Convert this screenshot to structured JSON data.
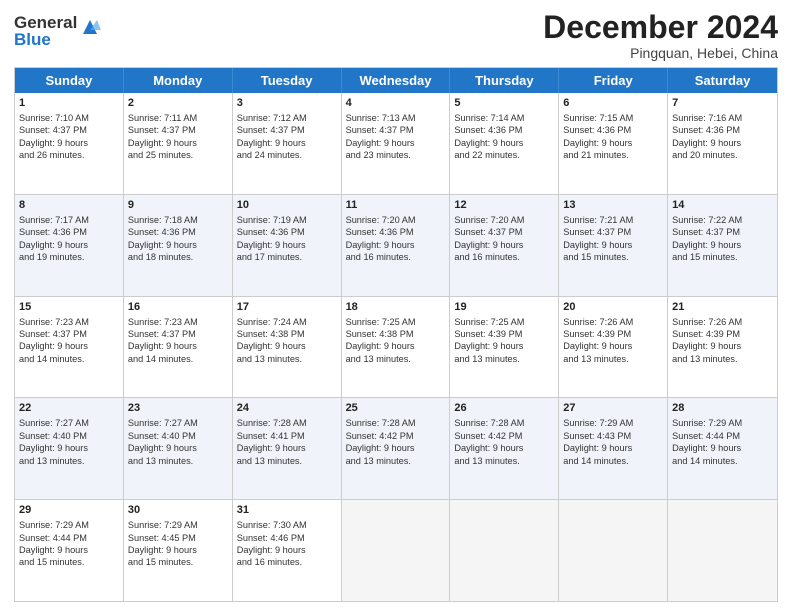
{
  "logo": {
    "general": "General",
    "blue": "Blue"
  },
  "title": "December 2024",
  "subtitle": "Pingquan, Hebei, China",
  "days": [
    "Sunday",
    "Monday",
    "Tuesday",
    "Wednesday",
    "Thursday",
    "Friday",
    "Saturday"
  ],
  "rows": [
    [
      {
        "day": "1",
        "lines": [
          "Sunrise: 7:10 AM",
          "Sunset: 4:37 PM",
          "Daylight: 9 hours",
          "and 26 minutes."
        ]
      },
      {
        "day": "2",
        "lines": [
          "Sunrise: 7:11 AM",
          "Sunset: 4:37 PM",
          "Daylight: 9 hours",
          "and 25 minutes."
        ]
      },
      {
        "day": "3",
        "lines": [
          "Sunrise: 7:12 AM",
          "Sunset: 4:37 PM",
          "Daylight: 9 hours",
          "and 24 minutes."
        ]
      },
      {
        "day": "4",
        "lines": [
          "Sunrise: 7:13 AM",
          "Sunset: 4:37 PM",
          "Daylight: 9 hours",
          "and 23 minutes."
        ]
      },
      {
        "day": "5",
        "lines": [
          "Sunrise: 7:14 AM",
          "Sunset: 4:36 PM",
          "Daylight: 9 hours",
          "and 22 minutes."
        ]
      },
      {
        "day": "6",
        "lines": [
          "Sunrise: 7:15 AM",
          "Sunset: 4:36 PM",
          "Daylight: 9 hours",
          "and 21 minutes."
        ]
      },
      {
        "day": "7",
        "lines": [
          "Sunrise: 7:16 AM",
          "Sunset: 4:36 PM",
          "Daylight: 9 hours",
          "and 20 minutes."
        ]
      }
    ],
    [
      {
        "day": "8",
        "lines": [
          "Sunrise: 7:17 AM",
          "Sunset: 4:36 PM",
          "Daylight: 9 hours",
          "and 19 minutes."
        ]
      },
      {
        "day": "9",
        "lines": [
          "Sunrise: 7:18 AM",
          "Sunset: 4:36 PM",
          "Daylight: 9 hours",
          "and 18 minutes."
        ]
      },
      {
        "day": "10",
        "lines": [
          "Sunrise: 7:19 AM",
          "Sunset: 4:36 PM",
          "Daylight: 9 hours",
          "and 17 minutes."
        ]
      },
      {
        "day": "11",
        "lines": [
          "Sunrise: 7:20 AM",
          "Sunset: 4:36 PM",
          "Daylight: 9 hours",
          "and 16 minutes."
        ]
      },
      {
        "day": "12",
        "lines": [
          "Sunrise: 7:20 AM",
          "Sunset: 4:37 PM",
          "Daylight: 9 hours",
          "and 16 minutes."
        ]
      },
      {
        "day": "13",
        "lines": [
          "Sunrise: 7:21 AM",
          "Sunset: 4:37 PM",
          "Daylight: 9 hours",
          "and 15 minutes."
        ]
      },
      {
        "day": "14",
        "lines": [
          "Sunrise: 7:22 AM",
          "Sunset: 4:37 PM",
          "Daylight: 9 hours",
          "and 15 minutes."
        ]
      }
    ],
    [
      {
        "day": "15",
        "lines": [
          "Sunrise: 7:23 AM",
          "Sunset: 4:37 PM",
          "Daylight: 9 hours",
          "and 14 minutes."
        ]
      },
      {
        "day": "16",
        "lines": [
          "Sunrise: 7:23 AM",
          "Sunset: 4:37 PM",
          "Daylight: 9 hours",
          "and 14 minutes."
        ]
      },
      {
        "day": "17",
        "lines": [
          "Sunrise: 7:24 AM",
          "Sunset: 4:38 PM",
          "Daylight: 9 hours",
          "and 13 minutes."
        ]
      },
      {
        "day": "18",
        "lines": [
          "Sunrise: 7:25 AM",
          "Sunset: 4:38 PM",
          "Daylight: 9 hours",
          "and 13 minutes."
        ]
      },
      {
        "day": "19",
        "lines": [
          "Sunrise: 7:25 AM",
          "Sunset: 4:39 PM",
          "Daylight: 9 hours",
          "and 13 minutes."
        ]
      },
      {
        "day": "20",
        "lines": [
          "Sunrise: 7:26 AM",
          "Sunset: 4:39 PM",
          "Daylight: 9 hours",
          "and 13 minutes."
        ]
      },
      {
        "day": "21",
        "lines": [
          "Sunrise: 7:26 AM",
          "Sunset: 4:39 PM",
          "Daylight: 9 hours",
          "and 13 minutes."
        ]
      }
    ],
    [
      {
        "day": "22",
        "lines": [
          "Sunrise: 7:27 AM",
          "Sunset: 4:40 PM",
          "Daylight: 9 hours",
          "and 13 minutes."
        ]
      },
      {
        "day": "23",
        "lines": [
          "Sunrise: 7:27 AM",
          "Sunset: 4:40 PM",
          "Daylight: 9 hours",
          "and 13 minutes."
        ]
      },
      {
        "day": "24",
        "lines": [
          "Sunrise: 7:28 AM",
          "Sunset: 4:41 PM",
          "Daylight: 9 hours",
          "and 13 minutes."
        ]
      },
      {
        "day": "25",
        "lines": [
          "Sunrise: 7:28 AM",
          "Sunset: 4:42 PM",
          "Daylight: 9 hours",
          "and 13 minutes."
        ]
      },
      {
        "day": "26",
        "lines": [
          "Sunrise: 7:28 AM",
          "Sunset: 4:42 PM",
          "Daylight: 9 hours",
          "and 13 minutes."
        ]
      },
      {
        "day": "27",
        "lines": [
          "Sunrise: 7:29 AM",
          "Sunset: 4:43 PM",
          "Daylight: 9 hours",
          "and 14 minutes."
        ]
      },
      {
        "day": "28",
        "lines": [
          "Sunrise: 7:29 AM",
          "Sunset: 4:44 PM",
          "Daylight: 9 hours",
          "and 14 minutes."
        ]
      }
    ],
    [
      {
        "day": "29",
        "lines": [
          "Sunrise: 7:29 AM",
          "Sunset: 4:44 PM",
          "Daylight: 9 hours",
          "and 15 minutes."
        ]
      },
      {
        "day": "30",
        "lines": [
          "Sunrise: 7:29 AM",
          "Sunset: 4:45 PM",
          "Daylight: 9 hours",
          "and 15 minutes."
        ]
      },
      {
        "day": "31",
        "lines": [
          "Sunrise: 7:30 AM",
          "Sunset: 4:46 PM",
          "Daylight: 9 hours",
          "and 16 minutes."
        ]
      },
      null,
      null,
      null,
      null
    ]
  ]
}
